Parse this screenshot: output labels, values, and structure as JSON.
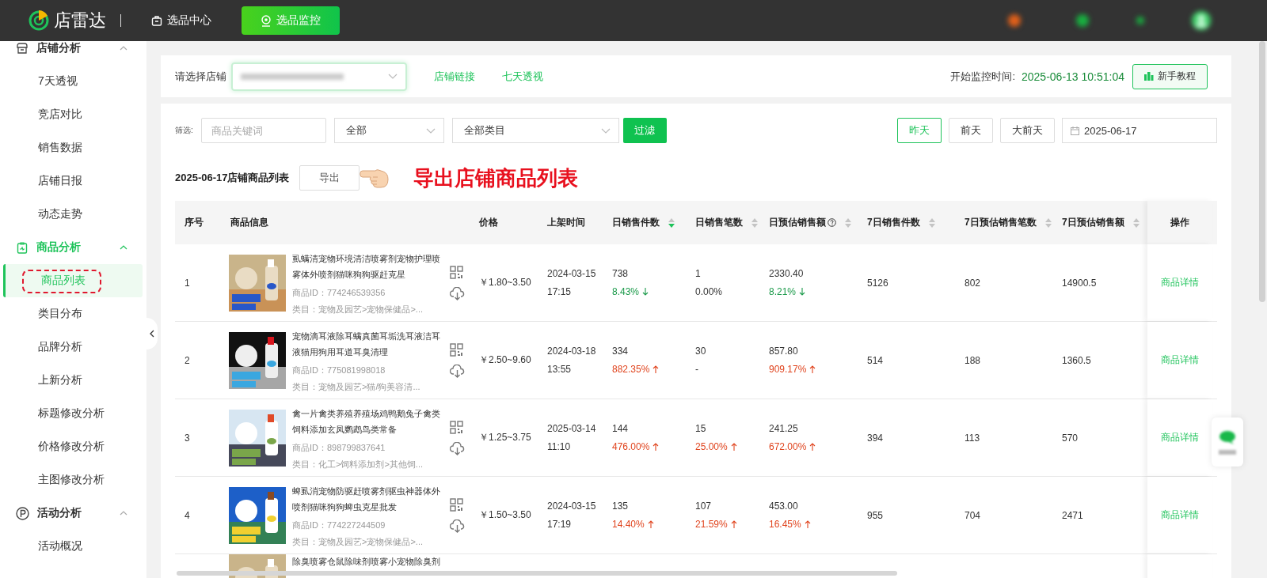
{
  "topbar": {
    "logo": "店雷达",
    "nav": [
      {
        "label": "选品中心",
        "selected": false
      },
      {
        "label": "选品监控",
        "selected": true
      }
    ]
  },
  "sidebar": {
    "groups": [
      {
        "label": "店铺分析",
        "expanded": true,
        "children": [
          {
            "label": "7天透视",
            "selected": false
          },
          {
            "label": "竞店对比",
            "selected": false
          },
          {
            "label": "销售数据",
            "selected": false
          },
          {
            "label": "店铺日报",
            "selected": false
          },
          {
            "label": "动态走势",
            "selected": false
          }
        ]
      },
      {
        "label": "商品分析",
        "expanded": true,
        "children": [
          {
            "label": "商品列表",
            "selected": true
          },
          {
            "label": "类目分布",
            "selected": false
          },
          {
            "label": "品牌分析",
            "selected": false
          },
          {
            "label": "上新分析",
            "selected": false
          },
          {
            "label": "标题修改分析",
            "selected": false
          },
          {
            "label": "价格修改分析",
            "selected": false
          },
          {
            "label": "主图修改分析",
            "selected": false
          }
        ]
      },
      {
        "label": "活动分析",
        "expanded": true,
        "children": [
          {
            "label": "活动概况",
            "selected": false
          }
        ]
      }
    ]
  },
  "store_bar": {
    "label": "请选择店铺",
    "links": [
      "店铺链接",
      "七天透视"
    ],
    "monitor_label": "开始监控时间:",
    "monitor_time": "2025-06-13 10:51:04",
    "tutorial_button": "新手教程"
  },
  "filter": {
    "label": "筛选:",
    "keyword_placeholder": "商品关键词",
    "status_select": "全部",
    "category_select": "全部类目",
    "filter_button": "过滤",
    "day_buttons": [
      {
        "label": "昨天",
        "selected": true
      },
      {
        "label": "前天",
        "selected": false
      },
      {
        "label": "大前天",
        "selected": false
      }
    ],
    "date": "2025-06-17"
  },
  "list_header": {
    "title": "2025-06-17店铺商品列表",
    "export_button": "导出",
    "annotation": "导出店铺商品列表"
  },
  "table": {
    "columns": [
      {
        "label": "序号"
      },
      {
        "label": "商品信息"
      },
      {
        "label": "价格"
      },
      {
        "label": "上架时间"
      },
      {
        "label": "日销售件数",
        "sorted": true
      },
      {
        "label": "日销售笔数",
        "sorted": false
      },
      {
        "label": "日预估销售额",
        "help": true,
        "sorted": false
      },
      {
        "label": "7日销售件数",
        "sorted": false
      },
      {
        "label": "7日预估销售笔数",
        "sorted": false
      },
      {
        "label": "7日预估销售额",
        "sorted": false
      },
      {
        "label": "操作"
      }
    ],
    "rows": [
      {
        "index": "1",
        "title": "虱螨清宠物环境清洁喷雾剂宠物护理喷雾体外喷剂猫咪狗狗驱赶克星",
        "product_id": "商品ID：774246539356",
        "category": "类目：宠物及园艺>宠物保健品>...",
        "price": "￥1.80~3.50",
        "listed_date": "2024-03-15",
        "listed_time": "17:15",
        "daily_units": "738",
        "daily_units_change": {
          "text": "8.43%",
          "kind": "down"
        },
        "daily_orders": "1",
        "daily_orders_change": {
          "text": "0.00%",
          "kind": "flat"
        },
        "daily_revenue": "2330.40",
        "daily_revenue_change": {
          "text": "8.21%",
          "kind": "down"
        },
        "units_7d": "5126",
        "orders_7d": "802",
        "revenue_7d": "14900.5",
        "action": "商品详情"
      },
      {
        "index": "2",
        "title": "宠物滴耳液除耳螨真菌耳垢洗耳液洁耳液猫用狗用耳道耳臭清理",
        "product_id": "商品ID：775081998018",
        "category": "类目：宠物及园艺>猫/狗美容清...",
        "price": "￥2.50~9.60",
        "listed_date": "2024-03-18",
        "listed_time": "13:55",
        "daily_units": "334",
        "daily_units_change": {
          "text": "882.35%",
          "kind": "up"
        },
        "daily_orders": "30",
        "daily_orders_change": {
          "text": "-",
          "kind": "flat"
        },
        "daily_revenue": "857.80",
        "daily_revenue_change": {
          "text": "909.17%",
          "kind": "up"
        },
        "units_7d": "514",
        "orders_7d": "188",
        "revenue_7d": "1360.5",
        "action": "商品详情"
      },
      {
        "index": "3",
        "title": "禽一片禽类养殖养殖场鸡鸭鹅兔子禽类饲料添加玄凤鹦鹉鸟类常备",
        "product_id": "商品ID：898799837641",
        "category": "类目：化工>饲料添加剂>其他饲...",
        "price": "￥1.25~3.75",
        "listed_date": "2025-03-14",
        "listed_time": "11:10",
        "daily_units": "144",
        "daily_units_change": {
          "text": "476.00%",
          "kind": "up"
        },
        "daily_orders": "15",
        "daily_orders_change": {
          "text": "25.00%",
          "kind": "up"
        },
        "daily_revenue": "241.25",
        "daily_revenue_change": {
          "text": "672.00%",
          "kind": "up"
        },
        "units_7d": "394",
        "orders_7d": "113",
        "revenue_7d": "570",
        "action": "商品详情"
      },
      {
        "index": "4",
        "title": "蜱虱消宠物防驱赶喷雾剂驱虫神器体外喷剂猫咪狗狗蜱虫克星批发",
        "product_id": "商品ID：774227244509",
        "category": "类目：宠物及园艺>宠物保健品>...",
        "price": "￥1.50~3.50",
        "listed_date": "2024-03-15",
        "listed_time": "17:19",
        "daily_units": "135",
        "daily_units_change": {
          "text": "14.40%",
          "kind": "up"
        },
        "daily_orders": "107",
        "daily_orders_change": {
          "text": "21.59%",
          "kind": "up"
        },
        "daily_revenue": "453.00",
        "daily_revenue_change": {
          "text": "16.45%",
          "kind": "up"
        },
        "units_7d": "955",
        "orders_7d": "704",
        "revenue_7d": "2471",
        "action": "商品详情"
      },
      {
        "title": "除臭喷雾仓鼠除味剂喷雾小宠物除臭剂"
      }
    ]
  }
}
